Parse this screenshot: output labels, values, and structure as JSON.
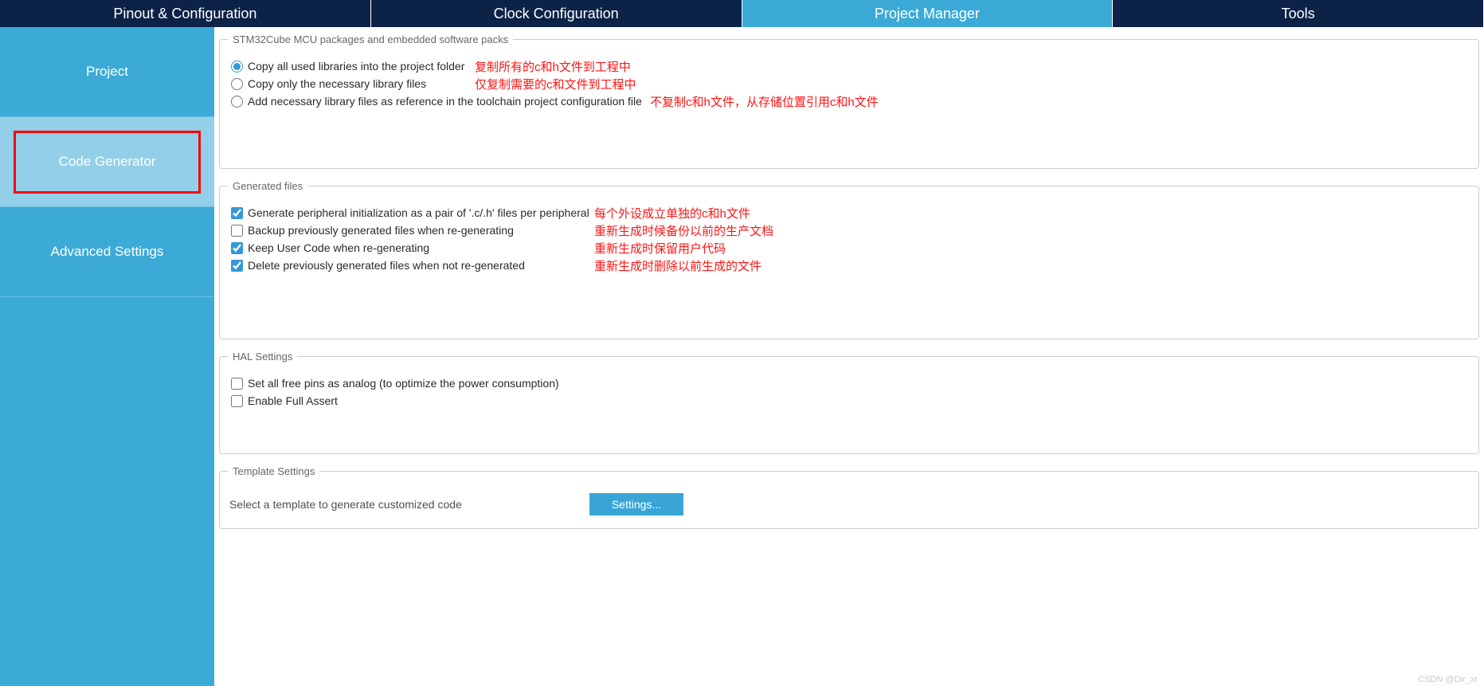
{
  "tabs": {
    "pinout": "Pinout & Configuration",
    "clock": "Clock Configuration",
    "project": "Project Manager",
    "tools": "Tools"
  },
  "sidebar": {
    "project": "Project",
    "codegen": "Code Generator",
    "advanced": "Advanced Settings"
  },
  "packages": {
    "legend": "STM32Cube MCU packages and embedded software packs",
    "opt1": "Copy all used libraries into the project folder",
    "opt2": "Copy only the necessary library files",
    "opt3": "Add necessary library files as reference in the toolchain project configuration file",
    "ann1": "复制所有的c和h文件到工程中",
    "ann2": "仅复制需要的c和文件到工程中",
    "ann3": "不复制c和h文件，从存储位置引用c和h文件"
  },
  "generated": {
    "legend": "Generated files",
    "opt1": "Generate peripheral initialization as a pair of '.c/.h' files per peripheral",
    "opt2": "Backup previously generated files when re-generating",
    "opt3": "Keep User Code when re-generating",
    "opt4": "Delete previously generated files when not re-generated",
    "ann1": "每个外设成立单独的c和h文件",
    "ann2": "重新生成时候备份以前的生产文档",
    "ann3": "重新生成时保留用户代码",
    "ann4": "重新生成时删除以前生成的文件"
  },
  "hal": {
    "legend": "HAL Settings",
    "opt1": "Set all free pins as analog (to optimize the power consumption)",
    "opt2": "Enable Full Assert"
  },
  "template": {
    "legend": "Template Settings",
    "desc": "Select a template to generate customized code",
    "button": "Settings..."
  },
  "watermark": "CSDN @Dir_xr"
}
